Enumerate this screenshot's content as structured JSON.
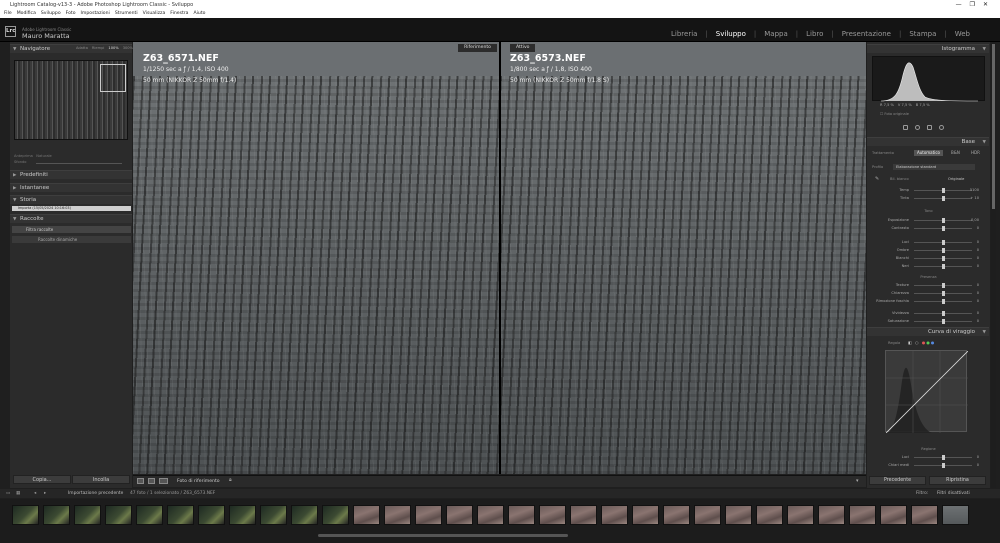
{
  "window": {
    "title": "Lightroom Catalog-v13-3 - Adobe Photoshop Lightroom Classic - Sviluppo",
    "controls": [
      "—",
      "❐",
      "✕"
    ]
  },
  "menu": [
    "File",
    "Modifica",
    "Sviluppo",
    "Foto",
    "Impostazioni",
    "Strumenti",
    "Visualizza",
    "Finestra",
    "Aiuto"
  ],
  "identity": {
    "logo": "Lrc",
    "app": "Adobe Lightroom Classic",
    "user": "Mauro Maratta"
  },
  "modules": {
    "items": [
      "Libreria",
      "Sviluppo",
      "Mappa",
      "Libro",
      "Presentazione",
      "Stampa",
      "Web"
    ],
    "active": "Sviluppo"
  },
  "left": {
    "navigator": "Navigatore",
    "zoom_opts": [
      "Adatta",
      "Riempi",
      "100%",
      "300%"
    ],
    "preview_opts": [
      "Anteprima",
      "Naturale"
    ],
    "preview_label": "Sfondo",
    "presets": "Predefiniti",
    "snapshots": "Istantanee",
    "history": "Storia",
    "history_item": "Importa (15/05/2024 10:16:03)",
    "collections": "Raccolte",
    "filter_collections": "Filtra raccolte",
    "dynamic_collections": "Raccolte dinamiche",
    "copy": "Copia...",
    "paste": "Incolla"
  },
  "center": {
    "left_tag": "Riferimento",
    "right_tag": "Attivo",
    "left": {
      "name": "Z63_6571.NEF",
      "exposure": "1/1250 sec a ƒ / 1,4, ISO 400",
      "lens": "50 mm (NIKKOR Z 50mm f/1.4)"
    },
    "right": {
      "name": "Z63_6573.NEF",
      "exposure": "1/800 sec a ƒ / 1,8, ISO 400",
      "lens": "50 mm (NIKKOR Z 50mm f/1.8 S)"
    },
    "toolbar_label": "Foto di riferimento"
  },
  "right": {
    "histogram": "Istogramma",
    "readout": [
      "R 7,5 %",
      "V 7,5 %",
      "B 7,5 %"
    ],
    "orig_photo": "Foto originale",
    "basic": "Base",
    "treatment_label": "Trattamento",
    "tabs": [
      "Automatico",
      "B&N",
      "HDR"
    ],
    "profile_label": "Profilo",
    "profile_value": "Elaborazione standard",
    "wb_label": "Bil. bianco",
    "wb_value": "Originale",
    "tone": "Tono",
    "presence": "Presenza",
    "sliders": [
      {
        "label": "Temp",
        "value": "5100"
      },
      {
        "label": "Tinta",
        "value": "+ 10"
      },
      {
        "label": "Esposizione",
        "value": "0,00"
      },
      {
        "label": "Contrasto",
        "value": "0"
      },
      {
        "label": "Luci",
        "value": "0"
      },
      {
        "label": "Ombre",
        "value": "0"
      },
      {
        "label": "Bianchi",
        "value": "0"
      },
      {
        "label": "Neri",
        "value": "0"
      },
      {
        "label": "Texture",
        "value": "0"
      },
      {
        "label": "Chiarezza",
        "value": "0"
      },
      {
        "label": "Rimozione foschia",
        "value": "0"
      },
      {
        "label": "Vividezza",
        "value": "0"
      },
      {
        "label": "Saturazione",
        "value": "0"
      }
    ],
    "curve": "Curva di viraggio",
    "curve_mode": "Regola",
    "region": "Regione",
    "region_sliders": [
      {
        "label": "Luci",
        "value": "0"
      },
      {
        "label": "Chiari medi",
        "value": "0"
      }
    ],
    "prev_btn": "Precedente",
    "reset_btn": "Ripristina"
  },
  "filmstrip": {
    "source": "Importazione precedente",
    "count": "47 foto / 1 selezionato / Z63_6573.NEF",
    "filter_label": "Filtro:",
    "filter_value": "Filtri disattivati"
  }
}
